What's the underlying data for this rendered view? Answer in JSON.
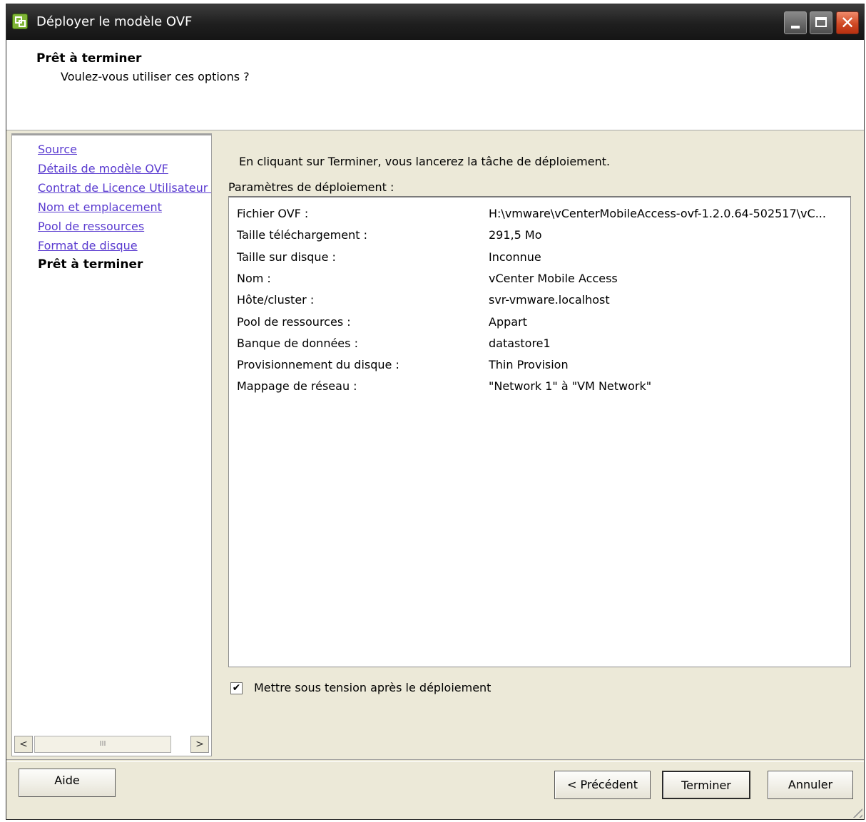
{
  "window": {
    "title": "Déployer le modèle OVF",
    "close_glyph": "✕",
    "icons": [
      "vmware-app-icon",
      "minimize-icon",
      "maximize-icon",
      "close-icon"
    ]
  },
  "header": {
    "title": "Prêt à terminer",
    "subtitle": "Voulez-vous utiliser ces options ?"
  },
  "nav": {
    "items": [
      {
        "label": "Source"
      },
      {
        "label": "Détails de modèle OVF"
      },
      {
        "label": "Contrat de Licence Utilisateur Final"
      },
      {
        "label": "Nom et emplacement"
      },
      {
        "label": "Pool de ressources"
      },
      {
        "label": "Format de disque"
      },
      {
        "label": "Prêt à terminer"
      }
    ],
    "current_index": 6,
    "scroll_left": "<",
    "scroll_thumb": "III",
    "scroll_right": ">"
  },
  "main": {
    "intro": "En cliquant sur Terminer, vous lancerez la tâche de déploiement.",
    "params_label": "Paramètres de déploiement :",
    "params": [
      {
        "key": "Fichier OVF :",
        "value": "H:\\vmware\\vCenterMobileAccess-ovf-1.2.0.64-502517\\vC..."
      },
      {
        "key": "Taille téléchargement :",
        "value": "291,5 Mo"
      },
      {
        "key": "Taille sur disque :",
        "value": "Inconnue"
      },
      {
        "key": "Nom :",
        "value": "vCenter Mobile Access"
      },
      {
        "key": "Hôte/cluster :",
        "value": "svr-vmware.localhost"
      },
      {
        "key": "Pool de ressources :",
        "value": "Appart"
      },
      {
        "key": "Banque de données :",
        "value": "datastore1"
      },
      {
        "key": "Provisionnement du disque :",
        "value": "Thin Provision"
      },
      {
        "key": "Mappage de réseau :",
        "value": "\"Network 1\" à \"VM Network\""
      }
    ],
    "power_on_checkbox": {
      "label": "Mettre sous tension après le déploiement",
      "checked": true,
      "mark": "✔"
    }
  },
  "footer": {
    "help": "Aide",
    "prev": "< Précédent",
    "finish": "Terminer",
    "cancel": "Annuler"
  }
}
